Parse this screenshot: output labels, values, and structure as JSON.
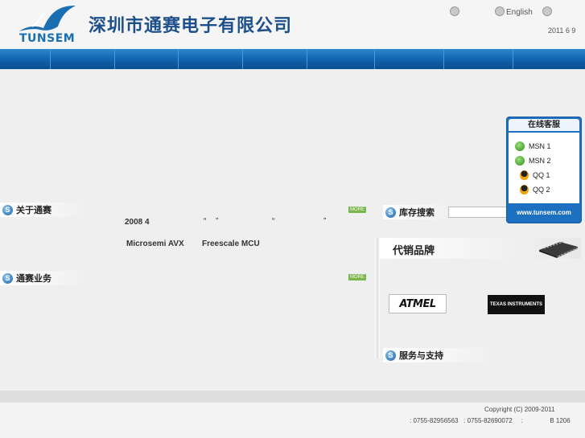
{
  "header": {
    "company_name": "深圳市通赛电子有限公司",
    "logo_text": "TUNSEM",
    "lang_label": "English",
    "date": "2011 6 9"
  },
  "nav": {
    "item_count": 9
  },
  "about": {
    "title": "关于通赛",
    "more": "MORE",
    "line1_year": "2008 4",
    "quote_open_1": "“",
    "quote_close_1": "”",
    "quote_open_2": "“",
    "quote_close_2": "”",
    "brands_line_a": "Microsemi AVX",
    "brands_line_b": "Freescale MCU"
  },
  "business": {
    "title": "通赛业务",
    "more": "MORE"
  },
  "stock_search": {
    "title": "库存搜索",
    "input_value": ""
  },
  "brands": {
    "title": "代销品牌",
    "atmel_logo": "ATMEL",
    "ti_logo": "TEXAS INSTRUMENTS"
  },
  "service": {
    "title": "服务与支持"
  },
  "customer_service": {
    "title": "在线客服",
    "items": [
      {
        "icon": "msn-icon",
        "label": "MSN  1"
      },
      {
        "icon": "msn-icon",
        "label": "MSN  2"
      },
      {
        "icon": "qq-icon",
        "label": "QQ  1"
      },
      {
        "icon": "qq-icon",
        "label": "QQ  2"
      }
    ],
    "footer": "www.tunsem.com"
  },
  "footer": {
    "copyright": "Copyright (C) 2009-2011",
    "contact": ": 0755-82956563   : 0755-82690072     :               B 1206"
  },
  "colors": {
    "brand_blue": "#1d4f8a",
    "nav_blue": "#0d5ea8",
    "more_green": "#78b54a"
  }
}
